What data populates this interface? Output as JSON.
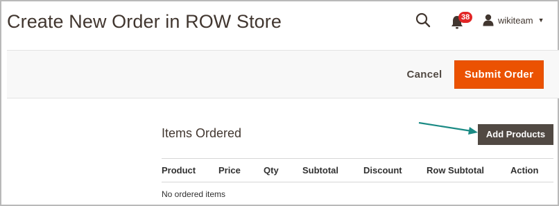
{
  "header": {
    "title": "Create New Order in ROW Store",
    "notifications_count": "38",
    "user_name": "wikiteam",
    "icons": {
      "search": "search-icon",
      "notifications": "bell-icon",
      "user": "user-icon",
      "menu": "caret-down-icon"
    }
  },
  "action_bar": {
    "cancel_label": "Cancel",
    "submit_label": "Submit Order"
  },
  "items_ordered": {
    "title": "Items Ordered",
    "add_products_label": "Add Products",
    "columns": [
      "Product",
      "Price",
      "Qty",
      "Subtotal",
      "Discount",
      "Row Subtotal",
      "Action"
    ],
    "empty_message": "No ordered items"
  },
  "colors": {
    "primary_button": "#eb5202",
    "secondary_button": "#514943",
    "badge": "#e22626",
    "annotation_arrow": "#1a8a84"
  }
}
